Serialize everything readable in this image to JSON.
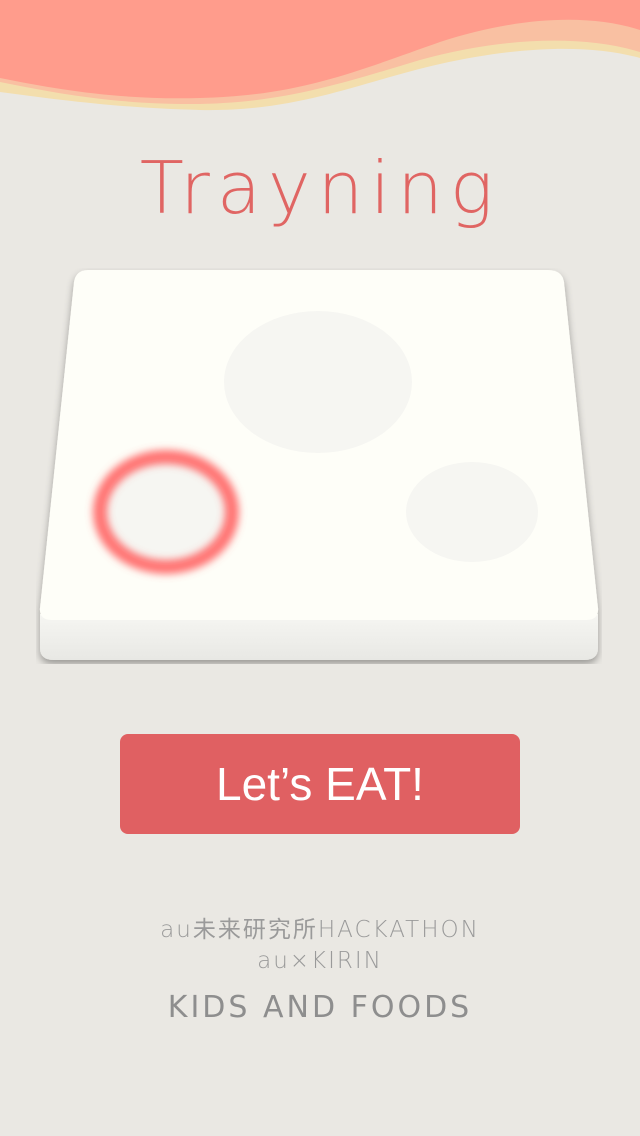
{
  "app": {
    "title": "Trayning"
  },
  "tray": {
    "highlighted_dish": "bottom-left"
  },
  "actions": {
    "start_label": "Let’s EAT!"
  },
  "footer": {
    "line1": "au未来研究所HACKATHON",
    "line2": "au×KIRIN",
    "line3": "KIDS AND FOODS"
  },
  "colors": {
    "background": "#EAE8E3",
    "accent": "#E06062",
    "title": "#E06563",
    "wave_top": "#FF9C8C",
    "wave_mid": "#F9C0A2",
    "wave_light": "#F3DEAD",
    "footer_text": "#9A9A9A"
  }
}
